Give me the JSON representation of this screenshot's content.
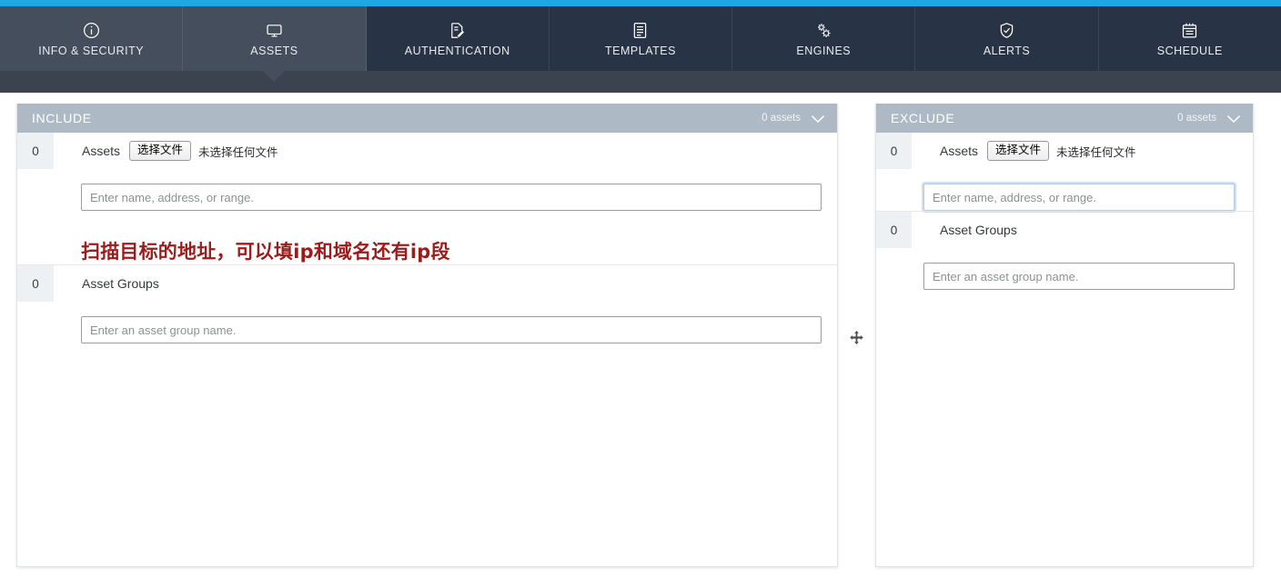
{
  "theme": {
    "accent_blue": "#19a8e8",
    "nav_bg": "#283445",
    "nav_active_bg": "#454e5c",
    "panel_header_bg": "#adbac6",
    "annotation_red": "#9c1b1b"
  },
  "nav": {
    "tabs": [
      {
        "id": "info-security",
        "label": "INFO & SECURITY",
        "icon": "info-circle-icon",
        "state": "visited"
      },
      {
        "id": "assets",
        "label": "ASSETS",
        "icon": "monitor-icon",
        "state": "active"
      },
      {
        "id": "authentication",
        "label": "AUTHENTICATION",
        "icon": "document-pen-icon",
        "state": "default"
      },
      {
        "id": "templates",
        "label": "TEMPLATES",
        "icon": "template-icon",
        "state": "default"
      },
      {
        "id": "engines",
        "label": "ENGINES",
        "icon": "gears-icon",
        "state": "default"
      },
      {
        "id": "alerts",
        "label": "ALERTS",
        "icon": "shield-check-icon",
        "state": "default"
      },
      {
        "id": "schedule",
        "label": "SCHEDULE",
        "icon": "calendar-icon",
        "state": "default"
      }
    ]
  },
  "include_panel": {
    "title": "INCLUDE",
    "count_label": "0 assets",
    "chevron_icon": "chevron-down-icon",
    "assets": {
      "count": "0",
      "label": "Assets",
      "file_button_label": "选择文件",
      "file_status": "未选择任何文件",
      "input_placeholder": "Enter name, address, or range.",
      "input_value": "",
      "annotation": "扫描目标的地址，可以填ip和域名还有ip段"
    },
    "asset_groups": {
      "count": "0",
      "label": "Asset Groups",
      "input_placeholder": "Enter an asset group name.",
      "input_value": ""
    }
  },
  "exclude_panel": {
    "title": "EXCLUDE",
    "count_label": "0 assets",
    "chevron_icon": "chevron-down-icon",
    "assets": {
      "count": "0",
      "label": "Assets",
      "file_button_label": "选择文件",
      "file_status": "未选择任何文件",
      "input_placeholder": "Enter name, address, or range.",
      "input_value": "",
      "input_focused": true
    },
    "asset_groups": {
      "count": "0",
      "label": "Asset Groups",
      "input_placeholder": "Enter an asset group name.",
      "input_value": ""
    }
  },
  "divider": {
    "handle_icon": "move-arrows-icon"
  }
}
